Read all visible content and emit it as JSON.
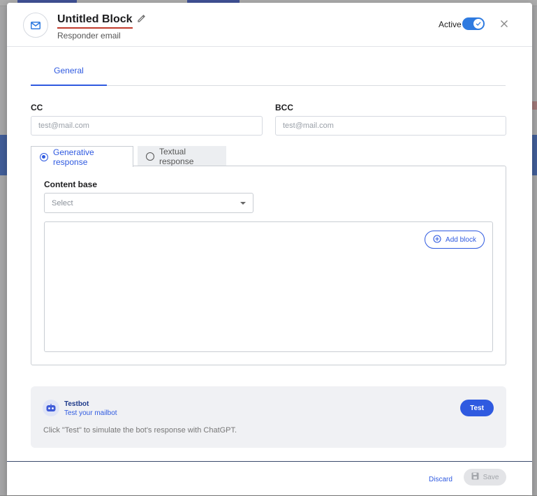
{
  "header": {
    "title": "Untitled Block",
    "subtitle": "Responder email",
    "active_label": "Active",
    "active": true
  },
  "tabs": [
    {
      "label": "General"
    }
  ],
  "cc": {
    "label": "CC",
    "placeholder": "test@mail.com",
    "value": ""
  },
  "bcc": {
    "label": "BCC",
    "placeholder": "test@mail.com",
    "value": ""
  },
  "response_tabs": [
    {
      "label": "Generative response",
      "selected": true
    },
    {
      "label": "Textual response",
      "selected": false
    }
  ],
  "content_base": {
    "label": "Content base",
    "placeholder": "Select"
  },
  "add_block_label": "Add block",
  "testbot": {
    "name": "Testbot",
    "subtitle": "Test your mailbot",
    "button": "Test",
    "hint": "Click \"Test\" to simulate the bot's response with ChatGPT."
  },
  "footer": {
    "discard": "Discard",
    "save": "Save"
  },
  "colors": {
    "accent": "#2f5ae0",
    "toggle": "#2f7be0",
    "title_underline": "#c0392b"
  },
  "icons": [
    "envelope-icon",
    "pencil-icon",
    "check-icon",
    "close-icon",
    "chevron-down-icon",
    "plus-circle-icon",
    "robot-icon",
    "floppy-disk-icon"
  ]
}
